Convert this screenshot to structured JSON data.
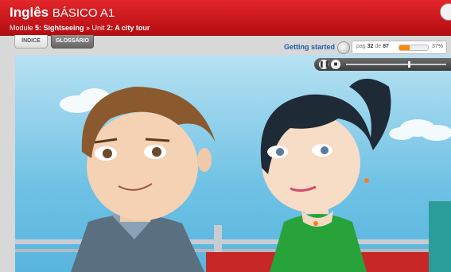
{
  "header": {
    "title_main": "Inglês",
    "title_level": "BÁSICO A1",
    "crumb_module_prefix": "Module ",
    "crumb_module": "5: Sightseeing",
    "crumb_sep": " » Unit ",
    "crumb_unit": "2: A city tour"
  },
  "tabs": {
    "indice": "ÍNDICE",
    "glossario": "GLOSSÁRIO"
  },
  "status": {
    "getting_started": "Getting started",
    "page_prefix": "pag ",
    "page_current": "32",
    "page_sep": " de ",
    "page_total": "87",
    "progress_percent_value": 37,
    "progress_percent_label": "37%"
  },
  "player": {
    "play_pause": "❚❚",
    "stop": "■",
    "seek_fraction": 0.62
  },
  "colors": {
    "header_red": "#d41d22",
    "progress_orange": "#ff8a00",
    "link_blue": "#1e5fa8"
  }
}
